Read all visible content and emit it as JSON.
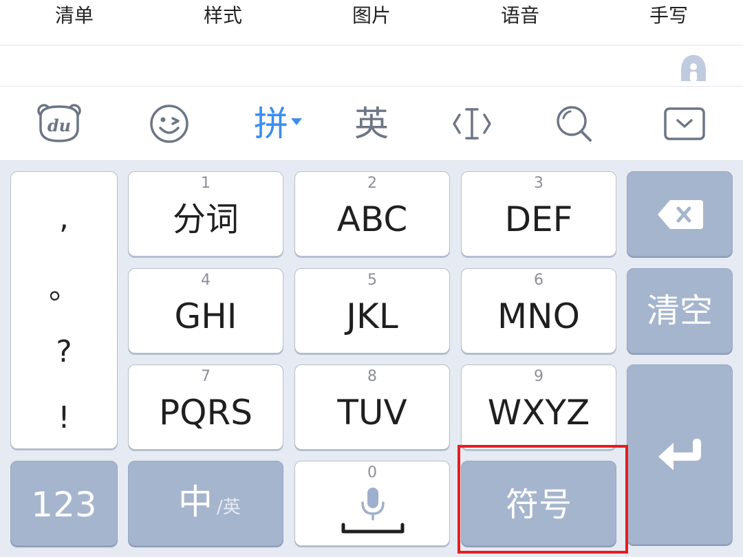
{
  "top_tabs": [
    "清单",
    "样式",
    "图片",
    "语音",
    "手写"
  ],
  "toolbar": {
    "mode_pinyin": "拼",
    "mode_english": "英",
    "icons": [
      "du-logo-icon",
      "emoji-icon",
      "pinyin-mode-dropdown",
      "english-mode",
      "text-cursor-icon",
      "search-icon",
      "hide-keyboard-icon"
    ]
  },
  "assist_icon": "assist-icon",
  "punctuation": [
    ",",
    "。",
    "?",
    "!"
  ],
  "keys": {
    "k1": {
      "num": "1",
      "label": "分词"
    },
    "k2": {
      "num": "2",
      "label": "ABC"
    },
    "k3": {
      "num": "3",
      "label": "DEF"
    },
    "k4": {
      "num": "4",
      "label": "GHI"
    },
    "k5": {
      "num": "5",
      "label": "JKL"
    },
    "k6": {
      "num": "6",
      "label": "MNO"
    },
    "k7": {
      "num": "7",
      "label": "PQRS"
    },
    "k8": {
      "num": "8",
      "label": "TUV"
    },
    "k9": {
      "num": "9",
      "label": "WXYZ"
    },
    "k0": {
      "num": "0"
    }
  },
  "side_keys": {
    "backspace_icon": "backspace-icon",
    "clear": "清空",
    "enter_icon": "enter-icon"
  },
  "bottom_row": {
    "num_switch": "123",
    "lang_zh": "中",
    "lang_en": "/英",
    "mic_icon": "microphone-icon",
    "symbols": "符号"
  },
  "colors": {
    "accent": "#3a8ef0",
    "dark_key": "#a6b5ce",
    "highlight": "#e51d1d",
    "keyboard_bg": "#e6eaf2"
  }
}
